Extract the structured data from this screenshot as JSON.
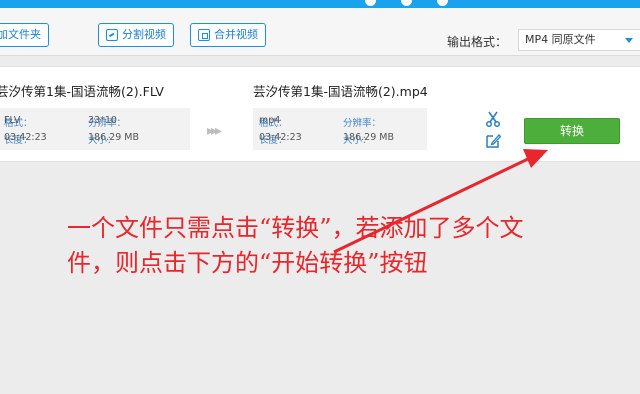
{
  "toolbar": {
    "add_file_label": "加文件夹",
    "split_label": "分割视频",
    "merge_label": "合并视频",
    "output_format_label": "输出格式：",
    "output_format_value": "MP4  同原文件"
  },
  "source": {
    "filename": "芸汐传第1集-国语流畅(2).FLV",
    "format_key": "格式：",
    "format_value": "FLV",
    "duration_key": "长度：",
    "duration_value": "03:42:23",
    "resolution_key": "分辨率：",
    "resolution_value": "33*10",
    "size_key": "大小：",
    "size_value": "186.29 MB"
  },
  "target": {
    "filename": "芸汐传第1集-国语流畅(2).mp4",
    "format_key": "格式：",
    "format_value": "mp4",
    "duration_key": "长度：",
    "duration_value": "03:42:23",
    "resolution_key": "分辨率：",
    "resolution_value": "",
    "size_key": "大小：",
    "size_value": "186.29 MB"
  },
  "convert_label": "转换",
  "annotation": "一个文件只需点击“转换”，若添加了多个文件，则点击下方的“开始转换”按钮",
  "colors": {
    "accent": "#1d8fe0",
    "convert_green": "#4dae3c",
    "annotation_red": "#e8262b"
  }
}
